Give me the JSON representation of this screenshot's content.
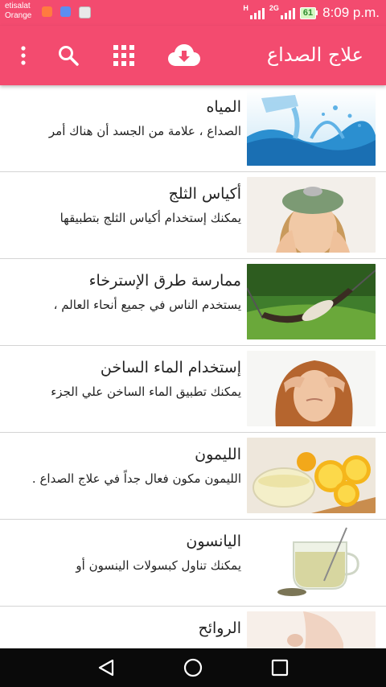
{
  "status_bar": {
    "carrier_line1": "etisalat",
    "carrier_line2": "Orange",
    "network_1": "H",
    "network_2": "2G",
    "battery": "61",
    "time": "8:09 p.m."
  },
  "app_bar": {
    "title": "علاج الصداع",
    "icons": [
      "overflow-menu-icon",
      "search-icon",
      "grid-icon",
      "cloud-download-icon"
    ],
    "accent_color": "#f34b6f"
  },
  "items": [
    {
      "title": "المياه",
      "description": "الصداع ، علامة من الجسد أن هناك أمر",
      "image": "water-splash"
    },
    {
      "title": "أكياس الثلج",
      "description": "يمكنك إستخدام أكياس الثلج بتطبيقها",
      "image": "ice-bag"
    },
    {
      "title": "ممارسة طرق الإسترخاء",
      "description": "يستخدم الناس في جميع أنحاء العالم ،",
      "image": "hammock"
    },
    {
      "title": "إستخدام الماء الساخن",
      "description": "يمكنك تطبيق الماء الساخن علي الجزء",
      "image": "headache-woman"
    },
    {
      "title": "الليمون",
      "description": "الليمون مكون فعال جداً في علاج الصداع .",
      "image": "lemons"
    },
    {
      "title": "اليانسون",
      "description": "يمكنك تناول كبسولات الينسون  أو",
      "image": "anise-tea"
    },
    {
      "title": "الروائح",
      "description": "",
      "image": "scents"
    }
  ],
  "nav_bar": {
    "icons": [
      "back-icon",
      "home-icon",
      "recents-icon"
    ]
  }
}
